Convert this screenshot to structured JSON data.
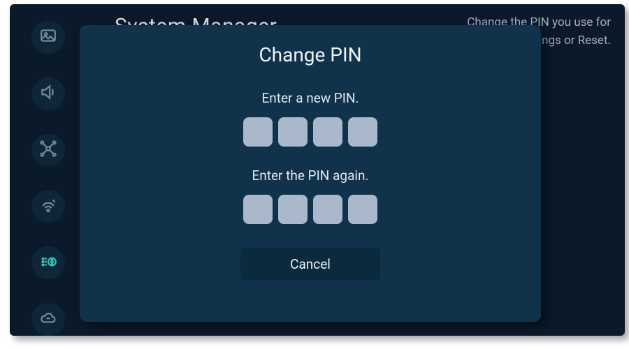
{
  "page": {
    "title": "System Manager",
    "help_text": "Change the PIN you use for Settings or Reset."
  },
  "sidebar": {
    "items": [
      {
        "name": "picture",
        "active": false
      },
      {
        "name": "sound",
        "active": false
      },
      {
        "name": "network",
        "active": false
      },
      {
        "name": "broadcast",
        "active": false
      },
      {
        "name": "accessibility",
        "active": true
      },
      {
        "name": "cloud",
        "active": false
      }
    ]
  },
  "modal": {
    "title": "Change PIN",
    "prompt_new": "Enter a new PIN.",
    "prompt_confirm": "Enter the PIN again.",
    "pin_length": 4,
    "cancel_label": "Cancel"
  },
  "colors": {
    "screen_bg": "#0b1a2a",
    "modal_bg": "#11324b",
    "pin_box": "#aab8cc",
    "accent": "#2ec7b6"
  }
}
